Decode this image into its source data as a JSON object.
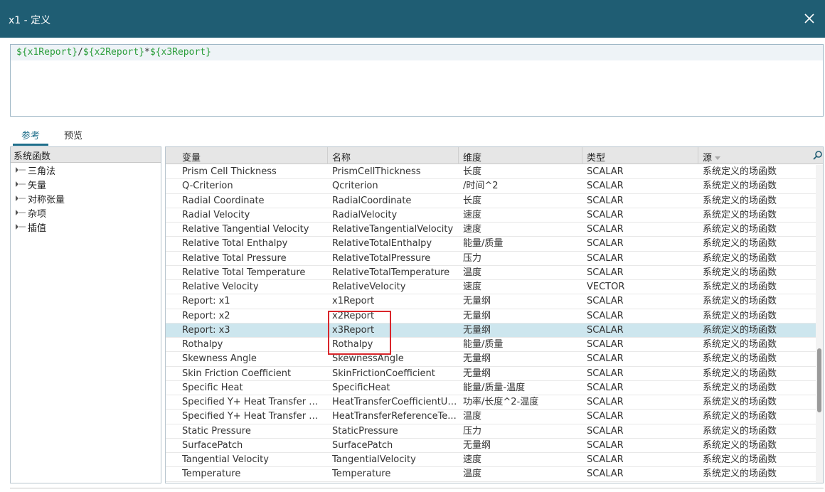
{
  "window": {
    "title": "x1 - 定义"
  },
  "editor": {
    "tokens": [
      "${x1Report}",
      "/",
      "${x2Report}",
      "*",
      "${x3Report}"
    ]
  },
  "tabs": [
    {
      "label": "参考",
      "active": true
    },
    {
      "label": "预览",
      "active": false
    }
  ],
  "left_panel": {
    "header": "系统函数",
    "items": [
      "三角法",
      "矢量",
      "对称张量",
      "杂项",
      "插值"
    ]
  },
  "grid": {
    "columns": [
      "变量",
      "名称",
      "维度",
      "类型",
      "源"
    ],
    "sorted_column": "源",
    "selected_row": 11,
    "highlighted_rows": [
      9,
      10,
      11
    ],
    "rows": [
      [
        "Prism Cell Thickness",
        "PrismCellThickness",
        "长度",
        "SCALAR",
        "系统定义的场函数"
      ],
      [
        "Q-Criterion",
        "Qcriterion",
        "/时间^2",
        "SCALAR",
        "系统定义的场函数"
      ],
      [
        "Radial Coordinate",
        "RadialCoordinate",
        "长度",
        "SCALAR",
        "系统定义的场函数"
      ],
      [
        "Radial Velocity",
        "RadialVelocity",
        "速度",
        "SCALAR",
        "系统定义的场函数"
      ],
      [
        "Relative Tangential Velocity",
        "RelativeTangentialVelocity",
        "速度",
        "SCALAR",
        "系统定义的场函数"
      ],
      [
        "Relative Total Enthalpy",
        "RelativeTotalEnthalpy",
        "能量/质量",
        "SCALAR",
        "系统定义的场函数"
      ],
      [
        "Relative Total Pressure",
        "RelativeTotalPressure",
        "压力",
        "SCALAR",
        "系统定义的场函数"
      ],
      [
        "Relative Total Temperature",
        "RelativeTotalTemperature",
        "温度",
        "SCALAR",
        "系统定义的场函数"
      ],
      [
        "Relative Velocity",
        "RelativeVelocity",
        "速度",
        "VECTOR",
        "系统定义的场函数"
      ],
      [
        "Report: x1",
        "x1Report",
        "无量纲",
        "SCALAR",
        "系统定义的场函数"
      ],
      [
        "Report: x2",
        "x2Report",
        "无量纲",
        "SCALAR",
        "系统定义的场函数"
      ],
      [
        "Report: x3",
        "x3Report",
        "无量纲",
        "SCALAR",
        "系统定义的场函数"
      ],
      [
        "Rothalpy",
        "Rothalpy",
        "能量/质量",
        "SCALAR",
        "系统定义的场函数"
      ],
      [
        "Skewness Angle",
        "SkewnessAngle",
        "无量纲",
        "SCALAR",
        "系统定义的场函数"
      ],
      [
        "Skin Friction Coefficient",
        "SkinFrictionCoefficient",
        "无量纲",
        "SCALAR",
        "系统定义的场函数"
      ],
      [
        "Specific Heat",
        "SpecificHeat",
        "能量/质量-温度",
        "SCALAR",
        "系统定义的场函数"
      ],
      [
        "Specified Y+ Heat Transfer Coe...",
        "HeatTransferCoefficientUs...",
        "功率/长度^2-温度",
        "SCALAR",
        "系统定义的场函数"
      ],
      [
        "Specified Y+ Heat Transfer Ref...",
        "HeatTransferReferenceTe...",
        "温度",
        "SCALAR",
        "系统定义的场函数"
      ],
      [
        "Static Pressure",
        "StaticPressure",
        "压力",
        "SCALAR",
        "系统定义的场函数"
      ],
      [
        "SurfacePatch",
        "SurfacePatch",
        "无量纲",
        "SCALAR",
        "系统定义的场函数"
      ],
      [
        "Tangential Velocity",
        "TangentialVelocity",
        "速度",
        "SCALAR",
        "系统定义的场函数"
      ],
      [
        "Temperature",
        "Temperature",
        "温度",
        "SCALAR",
        "系统定义的场函数"
      ]
    ]
  },
  "icons": {
    "close": "close-icon",
    "search": "search-icon",
    "expand": "expand-icon",
    "sort": "sort-down-icon"
  },
  "colors": {
    "titlebar": "#1f5d73",
    "selected_row": "#cde6ee",
    "highlight_box": "#d9262b",
    "expression_var": "#2a9d3a"
  }
}
